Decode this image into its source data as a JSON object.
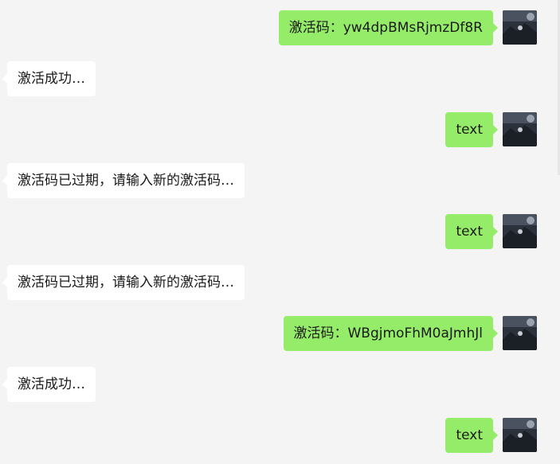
{
  "chat": {
    "messages": [
      {
        "side": "out",
        "text": "激活码：yw4dpBMsRjmzDf8R"
      },
      {
        "side": "in",
        "text": "激活成功…"
      },
      {
        "side": "out",
        "text": "text"
      },
      {
        "side": "in",
        "text": "激活码已过期，请输入新的激活码…"
      },
      {
        "side": "out",
        "text": "text"
      },
      {
        "side": "in",
        "text": "激活码已过期，请输入新的激活码…"
      },
      {
        "side": "out",
        "text": "激活码：WBgjmoFhM0aJmhJl"
      },
      {
        "side": "in",
        "text": "激活成功…"
      },
      {
        "side": "out",
        "text": "text"
      }
    ]
  },
  "colors": {
    "background": "#f4f4f4",
    "outgoing_bubble": "#95ec69",
    "incoming_bubble": "#ffffff",
    "text": "#1a1a1a"
  },
  "icons": {
    "avatar": "user-avatar-icon"
  }
}
